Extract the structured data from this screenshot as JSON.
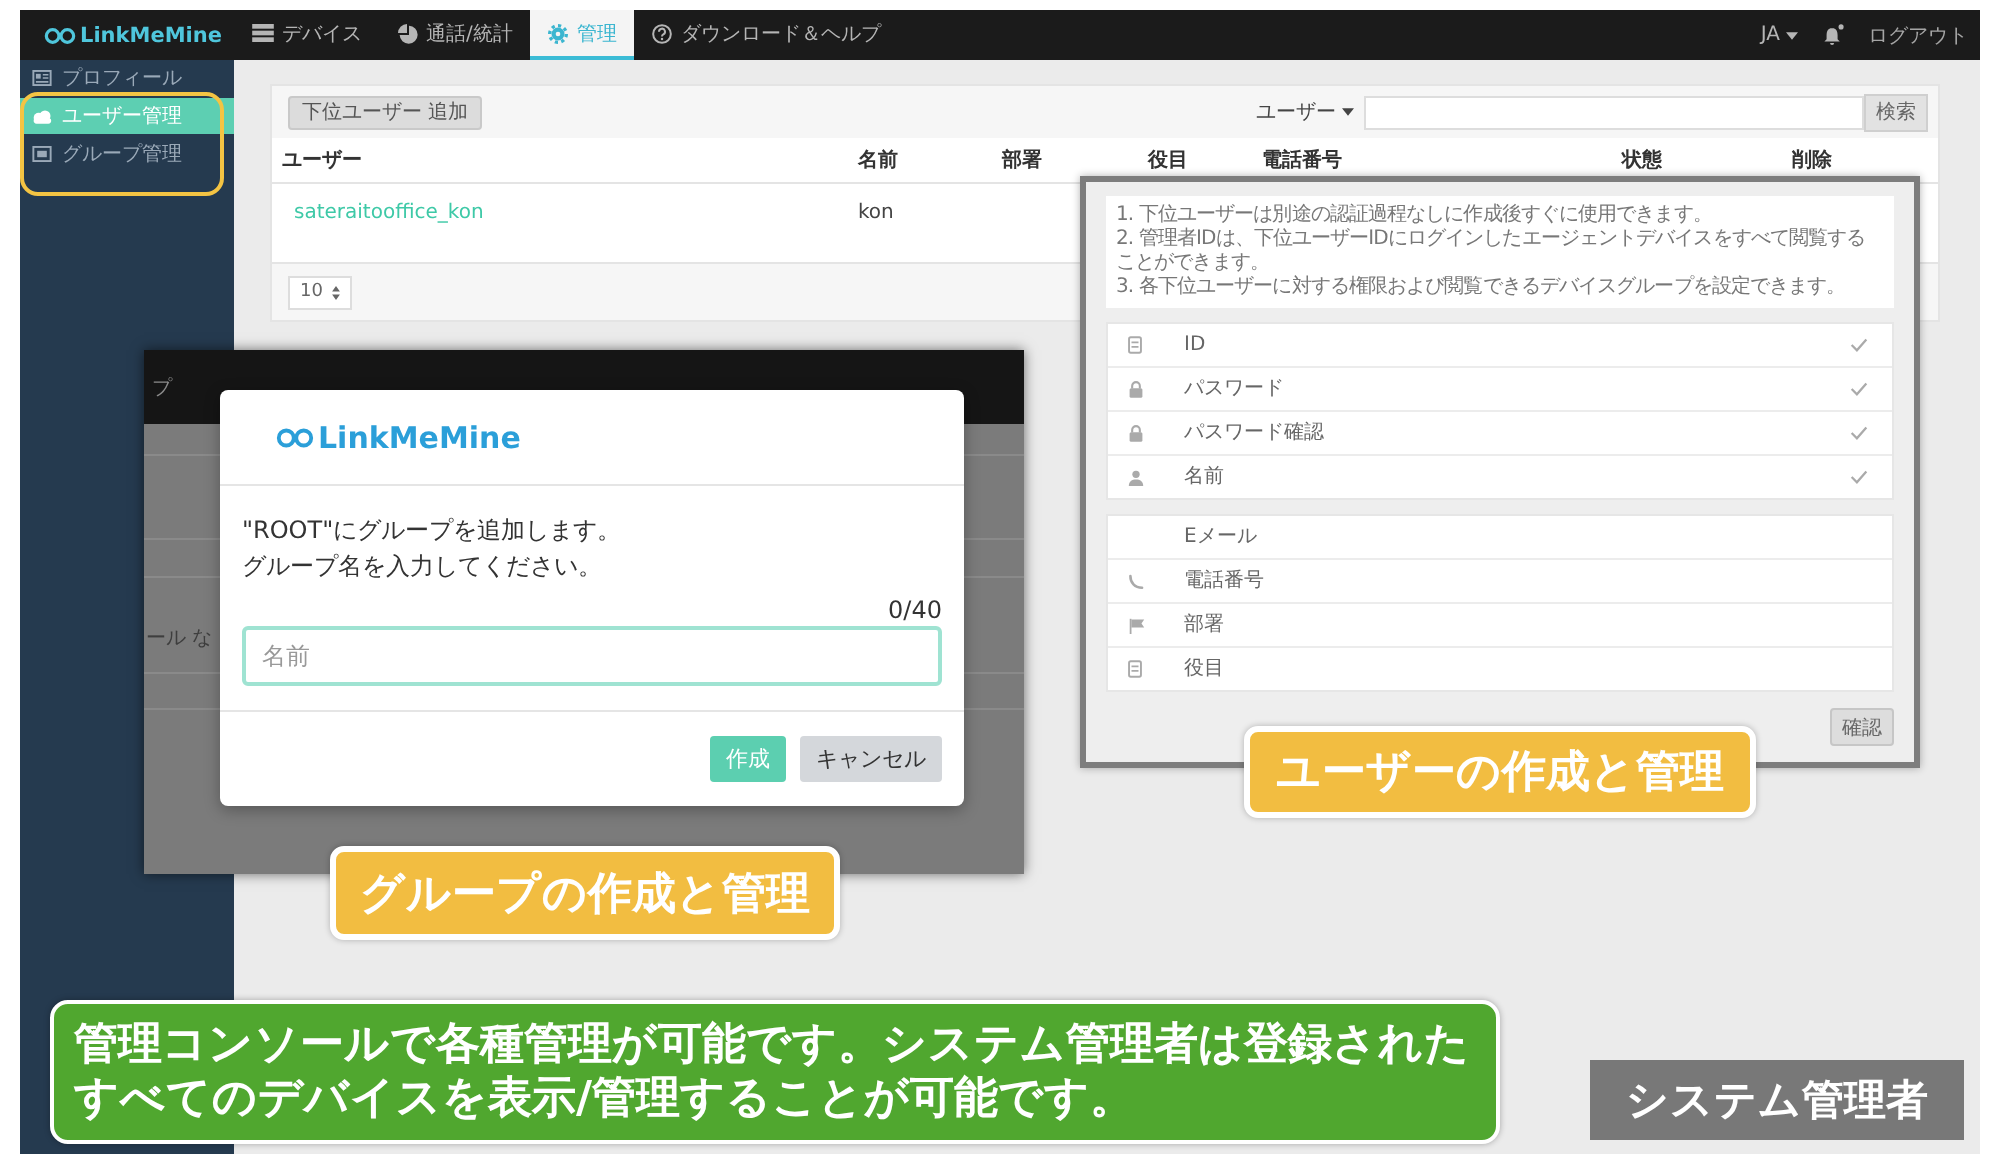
{
  "top_nav": {
    "logo": "LinkMeMine",
    "tabs": [
      {
        "label": "デバイス",
        "selected": false
      },
      {
        "label": "通話/統計",
        "selected": false
      },
      {
        "label": "管理",
        "selected": true
      },
      {
        "label": "ダウンロード＆ヘルプ",
        "selected": false
      }
    ],
    "language": "JA",
    "logout": "ログアウト"
  },
  "sidebar": {
    "items": [
      {
        "label": "プロフィール",
        "selected": false
      },
      {
        "label": "ユーザー管理",
        "selected": true
      },
      {
        "label": "グループ管理",
        "selected": false
      }
    ]
  },
  "users_card": {
    "add_button": "下位ユーザー 追加",
    "filter": "ユーザー",
    "search_button": "検索",
    "columns": [
      "ユーザー",
      "名前",
      "部署",
      "役目",
      "電話番号",
      "状態",
      "削除"
    ],
    "rows": [
      {
        "user": "sateraitooffice_kon",
        "name": "kon"
      }
    ],
    "page_size": "10"
  },
  "group_dialog": {
    "backdrop_texts": [
      "プ",
      "ール な"
    ],
    "logo": "LinkMeMine",
    "message_lines": [
      "\"ROOT\"にグループを追加します。",
      "グループ名を入力してください。"
    ],
    "counter": "0/40",
    "input": {
      "placeholder": "名前"
    },
    "buttons": [
      {
        "label": "作成",
        "kind": "primary"
      },
      {
        "label": "キャンセル",
        "kind": "secondary"
      }
    ]
  },
  "user_form": {
    "notes": [
      "1. 下位ユーザーは別途の認証過程なしに作成後すぐに使用できます。",
      "2. 管理者IDは、下位ユーザーIDにログインしたエージェントデバイスをすべて閲覧することができます。",
      "3. 各下位ユーザーに対する権限および閲覧できるデバイスグループを設定できます。"
    ],
    "required_fields": [
      {
        "placeholder": "ID",
        "checked": true
      },
      {
        "placeholder": "パスワード",
        "checked": true
      },
      {
        "placeholder": "パスワード確認",
        "checked": true
      },
      {
        "placeholder": "名前",
        "checked": true
      }
    ],
    "optional_fields": [
      {
        "placeholder": "Eメール"
      },
      {
        "placeholder": "電話番号"
      },
      {
        "placeholder": "部署"
      },
      {
        "placeholder": "役目"
      }
    ],
    "confirm_button": "確認"
  },
  "callouts": [
    {
      "text": "グループの作成と管理"
    },
    {
      "text": "ユーザーの作成と管理"
    }
  ],
  "banner": "管理コンソールで各種管理が可能です。システム管理者は登録されたすべてのデバイスを表示/管理することが可能です。",
  "role_label": "システム管理者"
}
